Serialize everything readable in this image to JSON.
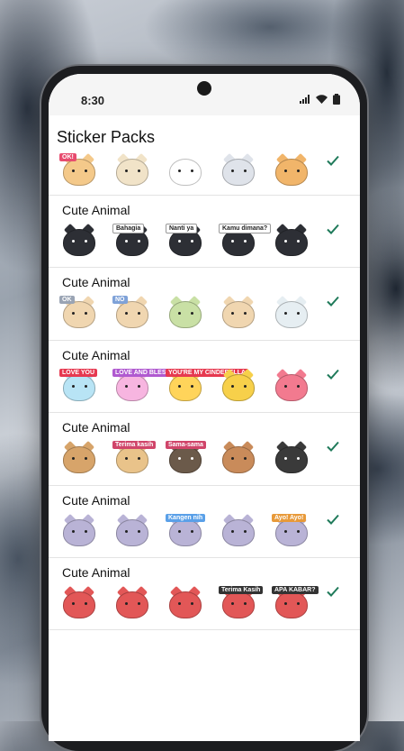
{
  "status_bar": {
    "time": "8:30"
  },
  "header": {
    "title": "Sticker Packs"
  },
  "packs": [
    {
      "title": "",
      "stickers": [
        {
          "icon": "cat-sticker",
          "color": "#f4c98a",
          "tag": "OK!",
          "tag_color": "#e74c6f"
        },
        {
          "icon": "cat-sticker",
          "color": "#f1e3c8",
          "tag": "",
          "tag_color": "#c9d84a"
        },
        {
          "icon": "cat-sticker",
          "color": "#ffffff",
          "tag": "",
          "tag_color": "#d04ad8"
        },
        {
          "icon": "cat-sticker",
          "color": "#dfe3ea",
          "tag": "",
          "tag_color": "#5aa9e6"
        },
        {
          "icon": "cat-sticker",
          "color": "#f1b56a",
          "tag": "",
          "tag_color": "#f08a2b"
        }
      ]
    },
    {
      "title": "Cute Animal",
      "stickers": [
        {
          "icon": "black-cat-sticker",
          "color": "#2d2f35",
          "tag": "",
          "tag_color": "#e74c6f"
        },
        {
          "icon": "black-cat-sticker",
          "color": "#2d2f35",
          "tag": "Bahagia",
          "tag_color": "#ffffff"
        },
        {
          "icon": "black-cat-sticker",
          "color": "#2d2f35",
          "tag": "Nanti ya",
          "tag_color": "#ffffff"
        },
        {
          "icon": "black-cat-sticker",
          "color": "#2d2f35",
          "tag": "Kamu dimana?",
          "tag_color": "#ffffff"
        },
        {
          "icon": "black-cat-sticker",
          "color": "#2d2f35",
          "tag": "",
          "tag_color": "#e74c6f"
        }
      ]
    },
    {
      "title": "Cute Animal",
      "stickers": [
        {
          "icon": "dog-cloud-sticker",
          "color": "#f0d6b0",
          "tag": "OK",
          "tag_color": "#9aa4b4"
        },
        {
          "icon": "dog-cloud-sticker",
          "color": "#f0d6b0",
          "tag": "NO",
          "tag_color": "#7fa2d8"
        },
        {
          "icon": "dog-cloud-sticker",
          "color": "#c9e0a5",
          "tag": "",
          "tag_color": "#f28ab0"
        },
        {
          "icon": "dog-cloud-sticker",
          "color": "#f0d6b0",
          "tag": "",
          "tag_color": "#b7a98f"
        },
        {
          "icon": "dog-cloud-sticker",
          "color": "#e6eef2",
          "tag": "",
          "tag_color": "#8fd3c5"
        }
      ]
    },
    {
      "title": "Cute Animal",
      "stickers": [
        {
          "icon": "love-card-sticker",
          "color": "#b8e4f5",
          "tag": "LOVE YOU",
          "tag_color": "#e63950"
        },
        {
          "icon": "bunny-sticker",
          "color": "#f7b5e0",
          "tag": "LOVE AND BLESS YOU",
          "tag_color": "#b05ad0"
        },
        {
          "icon": "duck-sticker",
          "color": "#ffd45a",
          "tag": "YOU'RE MY CINDERELLA",
          "tag_color": "#e63950"
        },
        {
          "icon": "love-card-sticker",
          "color": "#f7d04a",
          "tag": "",
          "tag_color": "#e63950"
        },
        {
          "icon": "bear-sticker",
          "color": "#f27a8f",
          "tag": "",
          "tag_color": "#e63950"
        }
      ]
    },
    {
      "title": "Cute Animal",
      "stickers": [
        {
          "icon": "shiba-sticker",
          "color": "#d7a46a",
          "tag": "",
          "tag_color": "#3b82c4"
        },
        {
          "icon": "shiba-sticker",
          "color": "#e9c38a",
          "tag": "Terima kasih",
          "tag_color": "#d0456a"
        },
        {
          "icon": "pug-sticker",
          "color": "#6b5a4a",
          "tag": "Sama-sama",
          "tag_color": "#d0456a"
        },
        {
          "icon": "bulldog-sticker",
          "color": "#c98b5a",
          "tag": "",
          "tag_color": "#ffffff"
        },
        {
          "icon": "frenchie-sticker",
          "color": "#3a3a3a",
          "tag": "",
          "tag_color": "#ffffff"
        }
      ]
    },
    {
      "title": "Cute Animal",
      "stickers": [
        {
          "icon": "koala-sticker",
          "color": "#b9b3d6",
          "tag": "",
          "tag_color": "#5aa0e8"
        },
        {
          "icon": "koala-sticker",
          "color": "#b9b3d6",
          "tag": "",
          "tag_color": "#5aa0e8"
        },
        {
          "icon": "koala-sticker",
          "color": "#b9b3d6",
          "tag": "Kangen nih",
          "tag_color": "#5aa0e8"
        },
        {
          "icon": "koala-sticker",
          "color": "#b9b3d6",
          "tag": "",
          "tag_color": "#e8748a"
        },
        {
          "icon": "koala-sticker",
          "color": "#b9b3d6",
          "tag": "Ayo! Ayo!",
          "tag_color": "#e89a3a"
        }
      ]
    },
    {
      "title": "Cute Animal",
      "stickers": [
        {
          "icon": "kids-sticker",
          "color": "#e25757",
          "tag": "",
          "tag_color": "#333333"
        },
        {
          "icon": "kids-sticker",
          "color": "#e25757",
          "tag": "",
          "tag_color": "#333333"
        },
        {
          "icon": "kids-sticker",
          "color": "#e25757",
          "tag": "",
          "tag_color": "#333333"
        },
        {
          "icon": "kids-sticker",
          "color": "#e25757",
          "tag": "Terima Kasih",
          "tag_color": "#333333"
        },
        {
          "icon": "kids-sticker",
          "color": "#e25757",
          "tag": "APA KABAR?",
          "tag_color": "#333333"
        }
      ]
    }
  ],
  "colors": {
    "accent_check": "#1f7a5a",
    "divider": "#e3e3e3"
  }
}
